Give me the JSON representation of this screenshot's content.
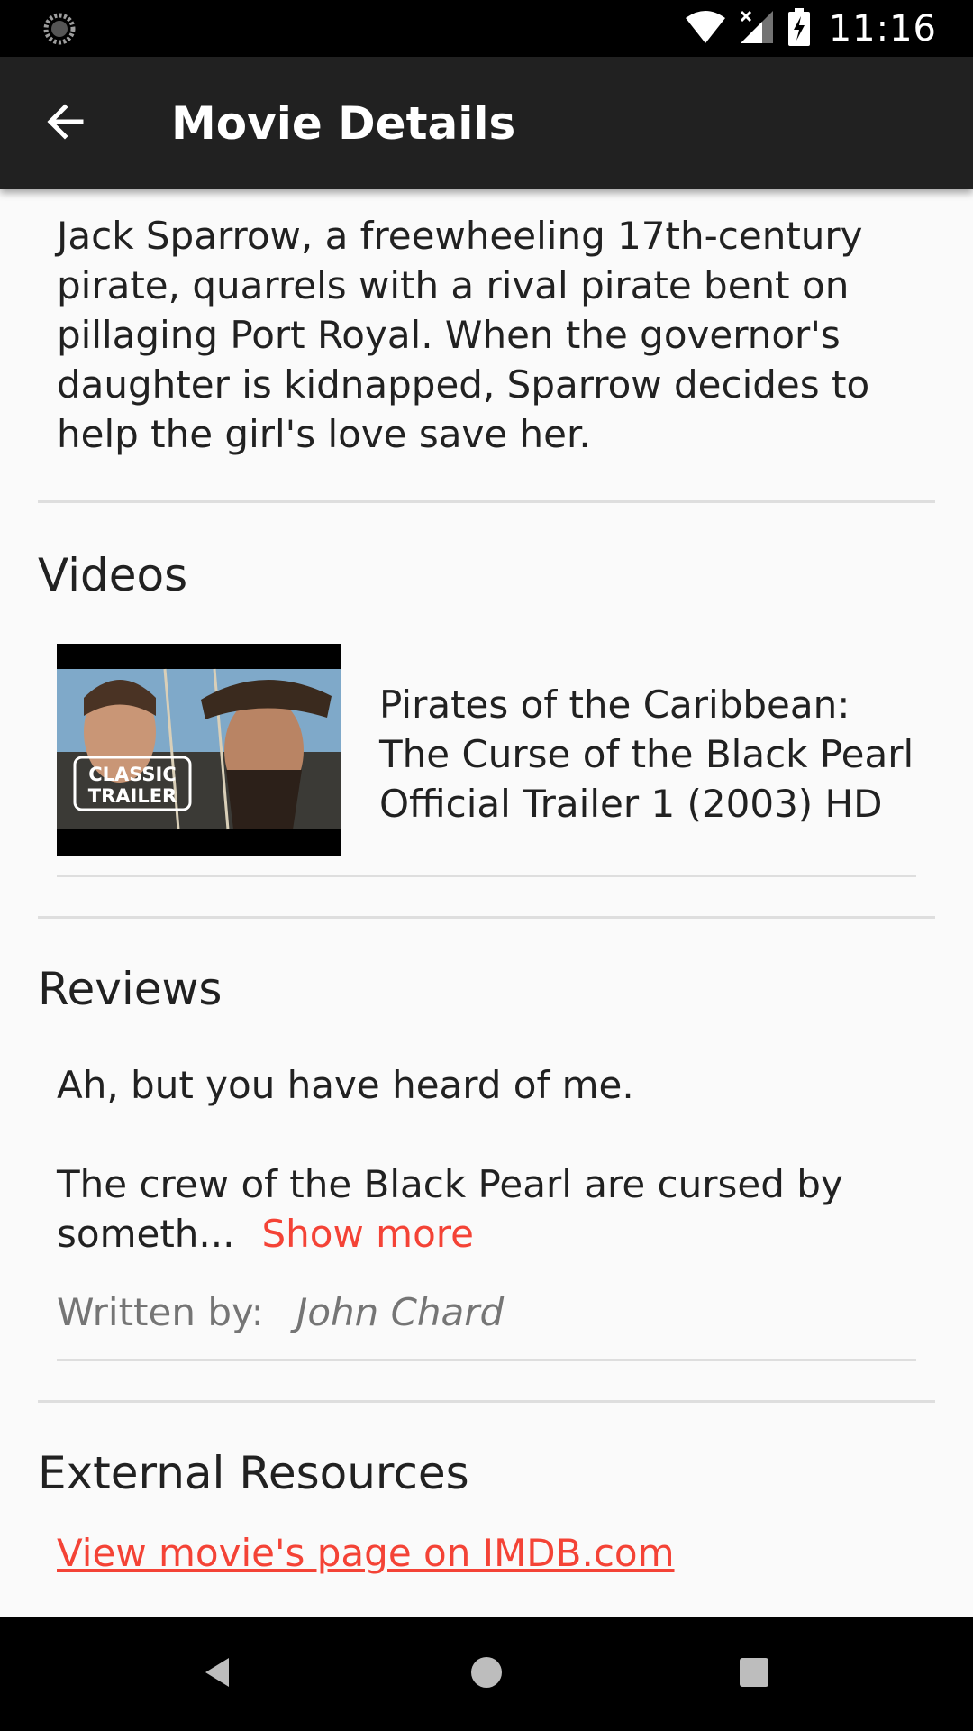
{
  "status_bar": {
    "time": "11:16",
    "icons": [
      "loading-icon",
      "wifi-icon",
      "signal-icon",
      "battery-charging-icon"
    ]
  },
  "app_bar": {
    "title": "Movie Details",
    "back_icon": "arrow-back-icon"
  },
  "overview": {
    "text": "Jack Sparrow, a freewheeling 17th-century pirate, quarrels with a rival pirate bent on pillaging Port Royal. When the governor's daughter is kidnapped, Sparrow decides to help the girl's love save her."
  },
  "videos": {
    "heading": "Videos",
    "items": [
      {
        "title": "Pirates of the Caribbean: The Curse of the Black Pearl Official Trailer 1 (2003) HD",
        "thumbnail_badge_line1": "CLASSIC",
        "thumbnail_badge_line2": "TRAILER"
      }
    ]
  },
  "reviews": {
    "heading": "Reviews",
    "items": [
      {
        "line1": "Ah, but you have heard of me.",
        "line2": "The crew of the Black Pearl are cursed by someth...",
        "show_more": "Show more",
        "written_by_label": "Written by:",
        "author": "John Chard"
      }
    ]
  },
  "external": {
    "heading": "External Resources",
    "imdb_link": "View movie's page on IMDB.com"
  },
  "colors": {
    "accent": "#f44336",
    "app_bar": "#212121",
    "background": "#fafafa"
  },
  "nav_bar": {
    "icons": [
      "back-triangle-icon",
      "home-circle-icon",
      "recents-square-icon"
    ]
  }
}
